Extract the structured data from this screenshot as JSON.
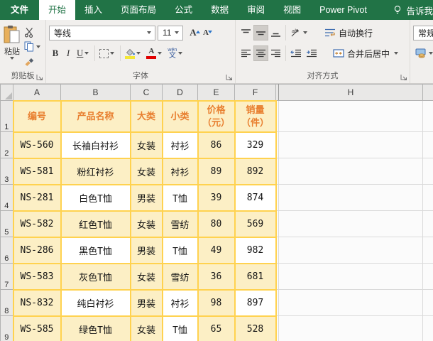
{
  "tabs": {
    "labels": [
      "文件",
      "开始",
      "插入",
      "页面布局",
      "公式",
      "数据",
      "审阅",
      "视图",
      "Power Pivot"
    ],
    "tell_me": "告诉我"
  },
  "ribbon": {
    "clipboard": {
      "label": "剪贴板",
      "paste": "粘贴"
    },
    "font": {
      "label": "字体",
      "font_name": "等线",
      "font_size": "11",
      "bold": "B",
      "italic": "I",
      "underline": "U",
      "grow_font": "A",
      "shrink_font": "A",
      "font_color_letter": "A",
      "pinyin_top": "wén",
      "pinyin_bottom": "文"
    },
    "alignment": {
      "label": "对齐方式",
      "orientation": "ab",
      "wrap_text": "自动换行",
      "merge_center": "合并后居中"
    },
    "number": {
      "format": "常规"
    }
  },
  "sheet": {
    "col_headers": [
      "A",
      "B",
      "C",
      "D",
      "E",
      "F",
      "H"
    ],
    "row_numbers": [
      "1",
      "2",
      "3",
      "4",
      "5",
      "6",
      "7",
      "8",
      "9"
    ],
    "table": {
      "headers": [
        "编号",
        "产品名称",
        "大类",
        "小类",
        "价格\n（元）",
        "销量\n（件）"
      ],
      "rows": [
        [
          "WS-560",
          "长袖白衬衫",
          "女装",
          "衬衫",
          "86",
          "329"
        ],
        [
          "WS-581",
          "粉红衬衫",
          "女装",
          "衬衫",
          "89",
          "892"
        ],
        [
          "NS-281",
          "白色T恤",
          "男装",
          "T恤",
          "39",
          "874"
        ],
        [
          "WS-582",
          "红色T恤",
          "女装",
          "雪纺",
          "80",
          "569"
        ],
        [
          "NS-286",
          "黑色T恤",
          "男装",
          "T恤",
          "49",
          "982"
        ],
        [
          "WS-583",
          "灰色T恤",
          "女装",
          "雪纺",
          "36",
          "681"
        ],
        [
          "NS-832",
          "纯白衬衫",
          "男装",
          "衬衫",
          "98",
          "897"
        ],
        [
          "WS-585",
          "绿色T恤",
          "女装",
          "T恤",
          "65",
          "528"
        ]
      ]
    }
  },
  "colors": {
    "excel_green": "#217346",
    "table_border_gold": "#FFD24F",
    "table_fill_yellow": "#FCEFC5",
    "header_text_orange": "#E87E2E",
    "fill_color_swatch": "#F3E737",
    "font_color_swatch": "#E00000"
  }
}
